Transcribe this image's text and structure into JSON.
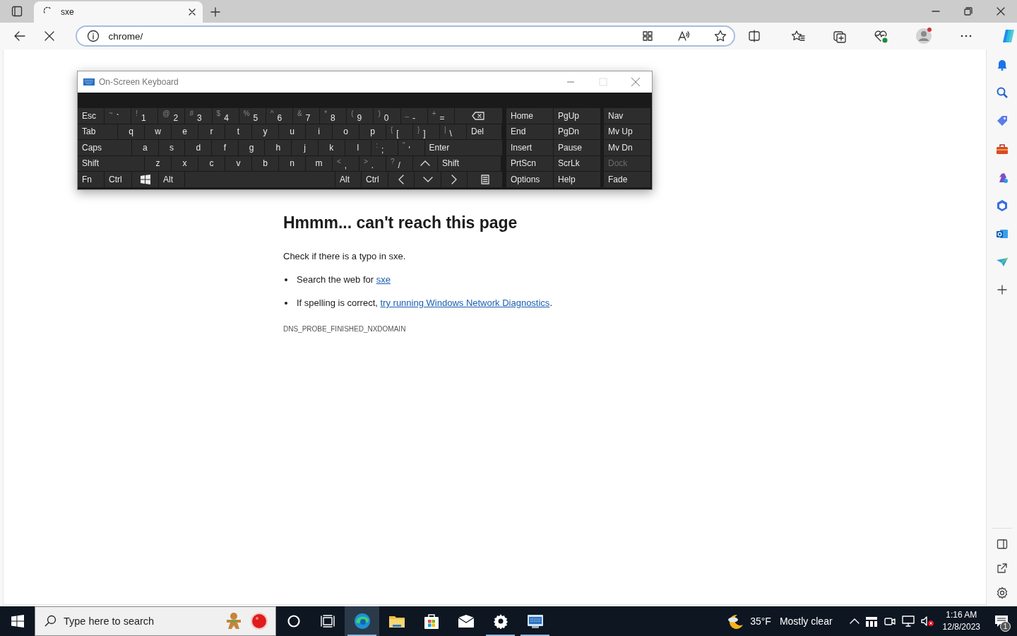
{
  "browser": {
    "tabs": [
      {
        "title": "sxe",
        "selected": true,
        "loading": true
      }
    ],
    "address": "chrome/",
    "profile_notification": true
  },
  "page": {
    "heading": "Hmmm... can't reach this page",
    "message": "Check if there is a typo in sxe.",
    "suggestions": [
      {
        "text": "Search the web for ",
        "link": "sxe"
      },
      {
        "text": "If spelling is correct, ",
        "link": "try running Windows Network Diagnostics",
        "after": "."
      }
    ],
    "error_code": "DNS_PROBE_FINISHED_NXDOMAIN"
  },
  "keyboard": {
    "title": "On-Screen Keyboard",
    "maximize_disabled": true,
    "rows": [
      {
        "keys": [
          {
            "kind": "mod",
            "label": "Esc"
          },
          {
            "kind": "char",
            "shift": "~",
            "label": "`"
          },
          {
            "kind": "char",
            "shift": "!",
            "label": "1"
          },
          {
            "kind": "char",
            "shift": "@",
            "label": "2"
          },
          {
            "kind": "char",
            "shift": "#",
            "label": "3"
          },
          {
            "kind": "char",
            "shift": "$",
            "label": "4"
          },
          {
            "kind": "char",
            "shift": "%",
            "label": "5"
          },
          {
            "kind": "char",
            "shift": "^",
            "label": "6"
          },
          {
            "kind": "char",
            "shift": "&",
            "label": "7"
          },
          {
            "kind": "char",
            "shift": "*",
            "label": "8"
          },
          {
            "kind": "char",
            "shift": "(",
            "label": "9"
          },
          {
            "kind": "char",
            "shift": ")",
            "label": "0"
          },
          {
            "kind": "char",
            "shift": "_",
            "label": "-"
          },
          {
            "kind": "char",
            "shift": "+",
            "label": "="
          },
          {
            "kind": "backspace"
          }
        ]
      },
      {
        "keys": [
          {
            "kind": "mod",
            "label": "Tab"
          },
          {
            "kind": "char",
            "label": "q"
          },
          {
            "kind": "char",
            "label": "w"
          },
          {
            "kind": "char",
            "label": "e"
          },
          {
            "kind": "char",
            "label": "r"
          },
          {
            "kind": "char",
            "label": "t"
          },
          {
            "kind": "char",
            "label": "y"
          },
          {
            "kind": "char",
            "label": "u"
          },
          {
            "kind": "char",
            "label": "i"
          },
          {
            "kind": "char",
            "label": "o"
          },
          {
            "kind": "char",
            "label": "p"
          },
          {
            "kind": "char",
            "shift": "{",
            "label": "["
          },
          {
            "kind": "char",
            "shift": "}",
            "label": "]"
          },
          {
            "kind": "char",
            "shift": "|",
            "label": "\\"
          },
          {
            "kind": "mod",
            "label": "Del"
          }
        ]
      },
      {
        "keys": [
          {
            "kind": "mod",
            "label": "Caps"
          },
          {
            "kind": "char",
            "label": "a"
          },
          {
            "kind": "char",
            "label": "s"
          },
          {
            "kind": "char",
            "label": "d"
          },
          {
            "kind": "char",
            "label": "f"
          },
          {
            "kind": "char",
            "label": "g"
          },
          {
            "kind": "char",
            "label": "h"
          },
          {
            "kind": "char",
            "label": "j"
          },
          {
            "kind": "char",
            "label": "k"
          },
          {
            "kind": "char",
            "label": "l"
          },
          {
            "kind": "char",
            "shift": ":",
            "label": ";"
          },
          {
            "kind": "char",
            "shift": "\"",
            "label": "'"
          },
          {
            "kind": "mod",
            "label": "Enter"
          }
        ]
      },
      {
        "keys": [
          {
            "kind": "mod",
            "label": "Shift"
          },
          {
            "kind": "char",
            "label": "z"
          },
          {
            "kind": "char",
            "label": "x"
          },
          {
            "kind": "char",
            "label": "c"
          },
          {
            "kind": "char",
            "label": "v"
          },
          {
            "kind": "char",
            "label": "b"
          },
          {
            "kind": "char",
            "label": "n"
          },
          {
            "kind": "char",
            "label": "m"
          },
          {
            "kind": "char",
            "shift": "<",
            "label": ","
          },
          {
            "kind": "char",
            "shift": ">",
            "label": "."
          },
          {
            "kind": "char",
            "shift": "?",
            "label": "/"
          },
          {
            "kind": "up"
          },
          {
            "kind": "mod",
            "label": "Shift"
          }
        ]
      },
      {
        "keys": [
          {
            "kind": "mod",
            "label": "Fn"
          },
          {
            "kind": "mod",
            "label": "Ctrl"
          },
          {
            "kind": "windows"
          },
          {
            "kind": "mod",
            "label": "Alt"
          },
          {
            "kind": "space"
          },
          {
            "kind": "mod",
            "label": "Alt"
          },
          {
            "kind": "mod",
            "label": "Ctrl"
          },
          {
            "kind": "left"
          },
          {
            "kind": "down"
          },
          {
            "kind": "right"
          },
          {
            "kind": "menu"
          }
        ]
      }
    ],
    "nav_keys": [
      [
        {
          "label": "Home",
          "disabled": false
        },
        {
          "label": "PgUp",
          "disabled": false
        },
        {
          "label": "Nav",
          "disabled": false
        }
      ],
      [
        {
          "label": "End",
          "disabled": false
        },
        {
          "label": "PgDn",
          "disabled": false
        },
        {
          "label": "Mv Up",
          "disabled": false
        }
      ],
      [
        {
          "label": "Insert",
          "disabled": false
        },
        {
          "label": "Pause",
          "disabled": false
        },
        {
          "label": "Mv Dn",
          "disabled": false
        }
      ],
      [
        {
          "label": "PrtScn",
          "disabled": false
        },
        {
          "label": "ScrLk",
          "disabled": false
        },
        {
          "label": "Dock",
          "disabled": true
        }
      ],
      [
        {
          "label": "Options",
          "disabled": false
        },
        {
          "label": "Help",
          "disabled": false
        },
        {
          "label": "Fade",
          "disabled": false
        }
      ]
    ]
  },
  "taskbar": {
    "search_placeholder": "Type here to search",
    "apps": [
      {
        "kind": "edge",
        "running": true,
        "focused": true
      },
      {
        "kind": "explorer",
        "running": false,
        "focused": false
      },
      {
        "kind": "store",
        "running": false,
        "focused": false
      },
      {
        "kind": "mail",
        "running": false,
        "focused": false
      },
      {
        "kind": "settings",
        "running": true,
        "focused": false
      },
      {
        "kind": "keyboard",
        "running": true,
        "focused": false
      }
    ],
    "weather": {
      "temperature": "35°F",
      "condition": "Mostly clear"
    },
    "clock": {
      "time": "1:16 AM",
      "date": "12/8/2023"
    },
    "notification_count": "1"
  }
}
